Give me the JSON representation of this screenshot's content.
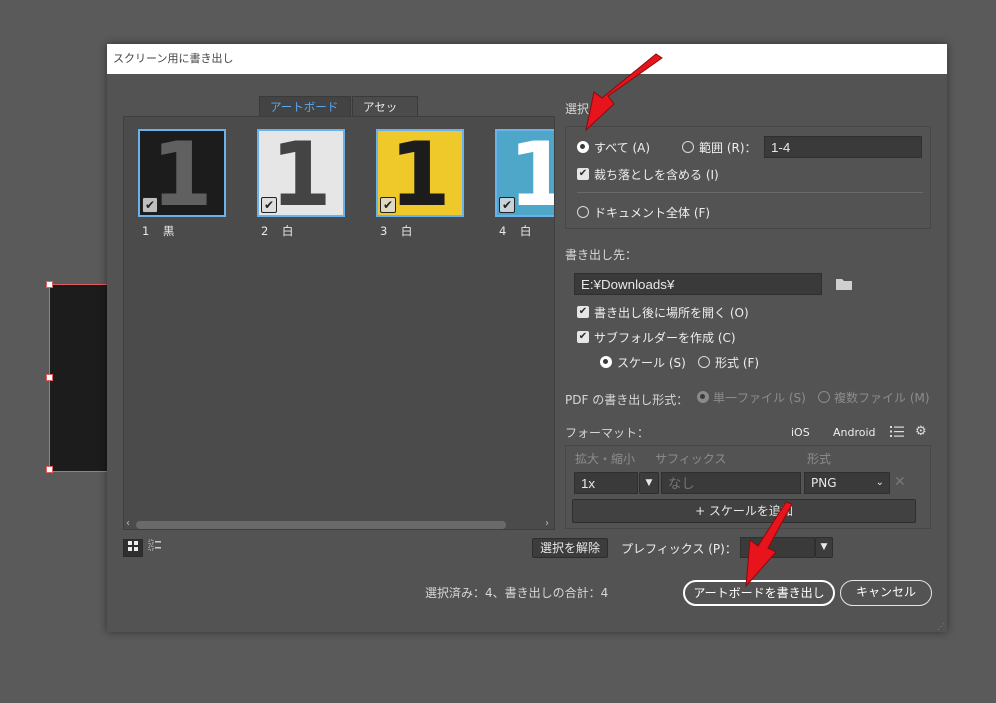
{
  "dialog": {
    "title": "スクリーン用に書き出し"
  },
  "tabs": {
    "artboards": "アートボード",
    "assets": "アセット"
  },
  "artboards": [
    {
      "digit": "1",
      "label": "1　黒",
      "bg": "#1c1c1c",
      "fg": "#606060"
    },
    {
      "digit": "1",
      "label": "2　白",
      "bg": "#e6e6e6",
      "fg": "#444444"
    },
    {
      "digit": "1",
      "label": "3　白",
      "bg": "#efc92a",
      "fg": "#1c1c1c"
    },
    {
      "digit": "1",
      "label": "4　白",
      "bg": "#4ea7c9",
      "fg": "#ffffff"
    }
  ],
  "selection": {
    "heading": "選択",
    "all_label": "すべて (A)",
    "range_label": "範囲 (R)：",
    "range_value": "1-4",
    "include_bleed_label": "裁ち落としを含める (I)",
    "full_document_label": "ドキュメント全体 (F)"
  },
  "export_to": {
    "heading": "書き出し先：",
    "path": "E:¥Downloads¥",
    "open_after_label": "書き出し後に場所を開く (O)",
    "create_subfolders_label": "サブフォルダーを作成 (C)",
    "scale_label": "スケール (S)",
    "format_label": "形式 (F)"
  },
  "pdf": {
    "heading": "PDF の書き出し形式：",
    "single_label": "単一ファイル (S)",
    "multiple_label": "複数ファイル (M)"
  },
  "formats": {
    "heading": "フォーマット：",
    "ios_label": "iOS",
    "android_label": "Android",
    "col_scale": "拡大・縮小",
    "col_suffix": "サフィックス",
    "col_format": "形式",
    "scale_value": "1x",
    "suffix_placeholder": "なし",
    "format_value": "PNG",
    "add_scale_label": "+ スケールを追加"
  },
  "bottom": {
    "deselect_label": "選択を解除",
    "prefix_label": "プレフィックス (P)：",
    "status": "選択済み：4、書き出しの合計：4",
    "export_button": "アートボードを書き出し",
    "cancel_button": "キャンセル"
  },
  "colors": {
    "accent": "#59a7f0",
    "annotation_arrow": "#e8141c"
  }
}
